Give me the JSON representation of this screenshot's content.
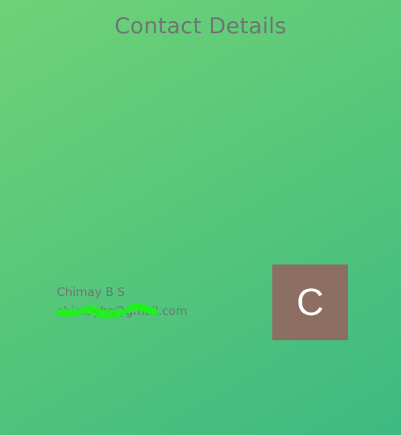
{
  "header": {
    "title": "Contact Details"
  },
  "contact": {
    "name": "Chimay B S",
    "email": "chimaybs@gmail.com",
    "avatar_initial": "C",
    "avatar_color": "#8d6e63"
  },
  "colors": {
    "background_start": "#6fd277",
    "background_end": "#3dba80",
    "text": "#6f7575",
    "redaction": "#22ee22"
  }
}
